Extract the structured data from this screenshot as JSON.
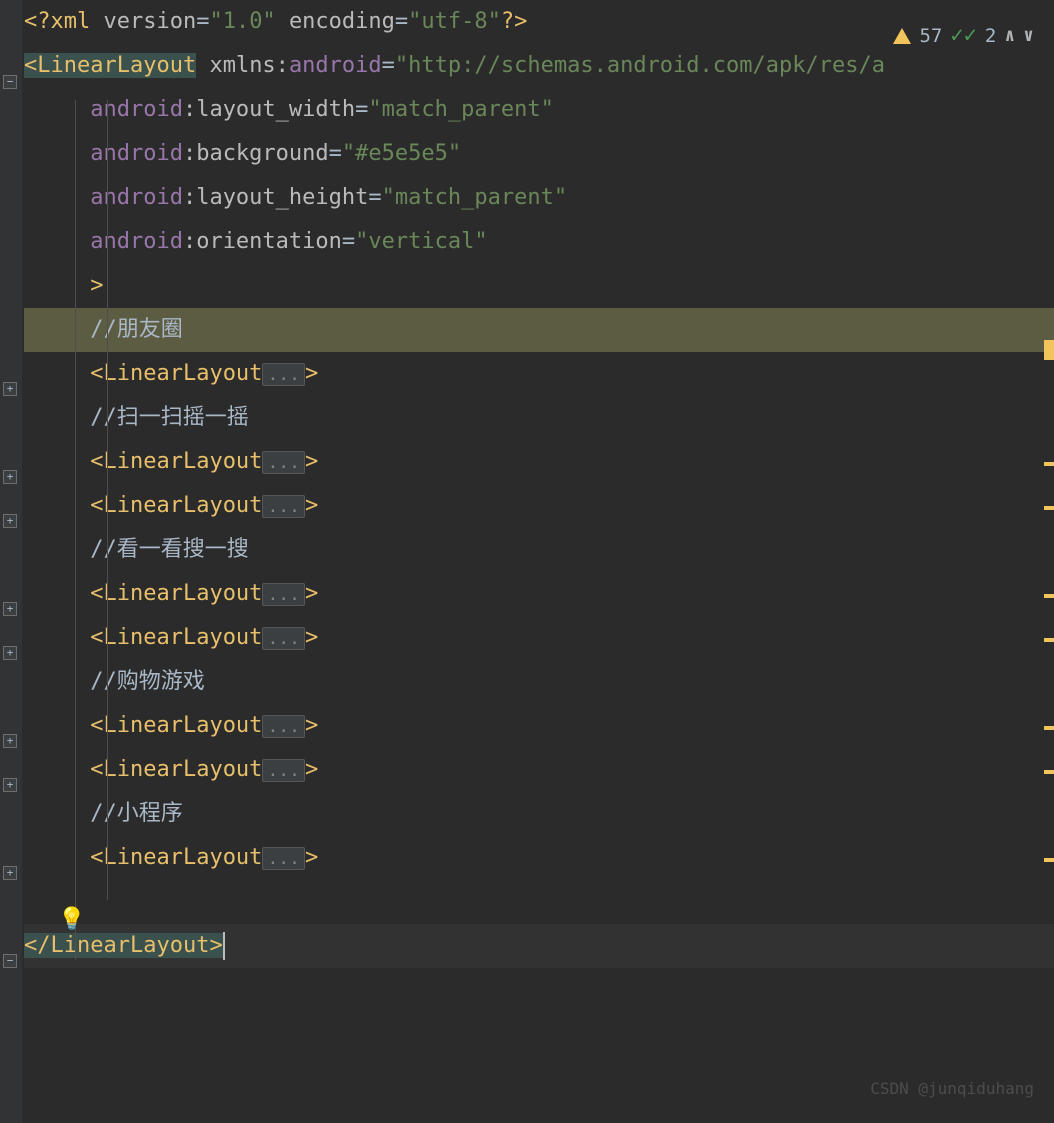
{
  "indicators": {
    "warnings": "57",
    "checks": "2"
  },
  "code": {
    "xml_decl_open": "<?",
    "xml": "xml ",
    "version_attr": "version",
    "version_val": "\"1.0\"",
    "encoding_attr": "encoding",
    "encoding_val": "\"utf-8\"",
    "xml_decl_close": "?>",
    "open_bracket": "<",
    "close_bracket": ">",
    "close_tag_bracket": "</",
    "linearlayout": "LinearLayout",
    "xmlns_attr": "xmlns:",
    "android_ns": "android",
    "schema_val": "\"http://schemas.android.com/apk/res/a",
    "layout_width": ":layout_width",
    "match_parent": "\"match_parent\"",
    "background": ":background",
    "bg_color": "\"#e5e5e5\"",
    "layout_height": ":layout_height",
    "orientation": ":orientation",
    "vertical": "\"vertical\"",
    "comment_prefix": "//",
    "comment1": "朋友圈",
    "comment2": "扫一扫摇一摇",
    "comment3": "看一看搜一搜",
    "comment4": "购物游戏",
    "comment5": "小程序",
    "fold": "..."
  },
  "watermark": "CSDN @junqiduhang"
}
